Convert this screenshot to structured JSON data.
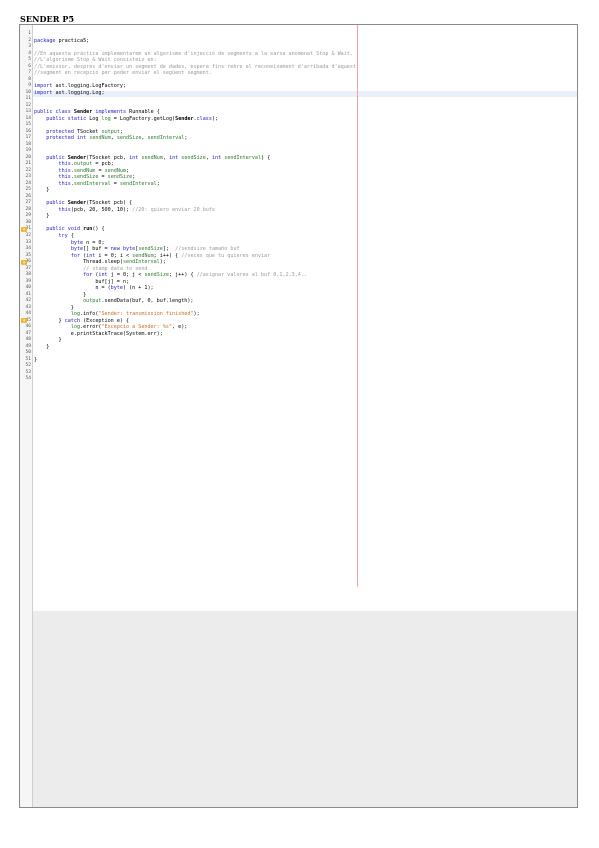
{
  "page_title": "SENDER P5",
  "code_lines": [
    "",
    "package practica5;",
    "",
    "//En aquesta pràctica implementarem un algorisme d'injecció de segments a la xarxa anomenat Stop & Wait.",
    "//L'algorisme Stop & Wait consisteix en:",
    "//L'emissor, després d'enviar un segment de dades, espera fins rebre el reconeixement d'arribada d'aquest",
    "//segment en recepció per poder enviar el següent segment.",
    "",
    "import ast.logging.LogFactory;",
    "import ast.logging.Log;",
    "",
    "",
    "public class Sender implements Runnable {",
    "    public static Log log = LogFactory.getLog(Sender.class);",
    "",
    "    protected TSocket output;",
    "    protected int sendNum, sendSize, sendInterval;",
    "",
    "",
    "    public Sender(TSocket pcb, int sendNum, int sendSize, int sendInterval) {",
    "        this.output = pcb;",
    "        this.sendNum = sendNum;",
    "        this.sendSize = sendSize;",
    "        this.sendInterval = sendInterval;",
    "    }",
    "",
    "    public Sender(TSocket pcb) {",
    "        this(pcb, 20, 500, 10); //20: quiero enviar 20 bufs",
    "    }",
    "",
    "    public void run() {",
    "        try {",
    "            byte n = 0;",
    "            byte[] buf = new byte[sendSize];  //sendsize tamaño buf",
    "            for (int i = 0; i < sendNum; i++) { //veces que tu quieres enviar",
    "                Thread.sleep(sendInterval);",
    "                // stamp data to send",
    "                for (int j = 0; j < sendSize; j++) { //asignar valores al buf 0,1,2,3,4..",
    "                    buf[j] = n;",
    "                    n = (byte) (n + 1);",
    "                }",
    "                output.sendData(buf, 0, buf.length);",
    "            }",
    "            log.info(\"Sender: transmission finished\");",
    "        } catch (Exception e) {",
    "            log.error(\"Excepcio a Sender: %s\", e);",
    "            e.printStackTrace(System.err);",
    "        }",
    "    }",
    "",
    "}",
    "",
    "",
    ""
  ],
  "warning_lines": [
    31,
    36,
    45
  ],
  "colors": {
    "keyword": "#2020c8",
    "comment": "#9a9a9a",
    "string": "#c07020",
    "field": "#2a7a2a",
    "warning": "#e8b830",
    "margin_line": "#f2a0a0"
  }
}
